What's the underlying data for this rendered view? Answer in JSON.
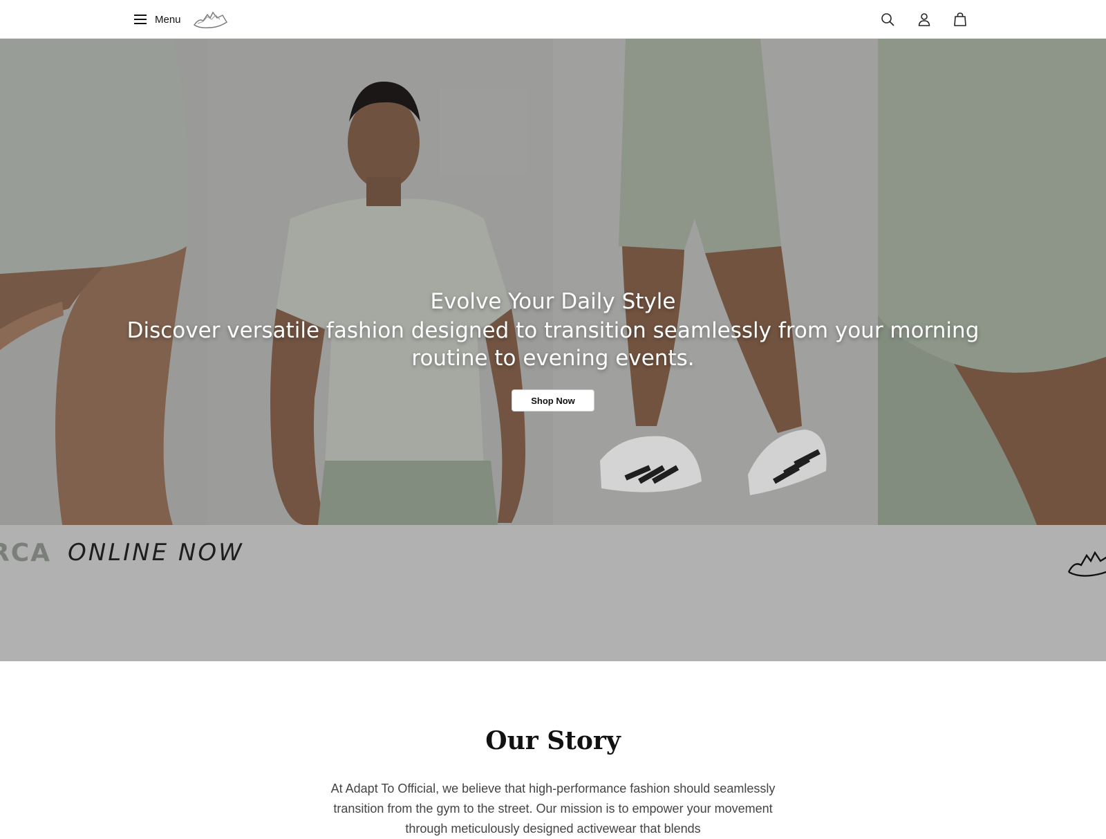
{
  "header": {
    "menu_label": "Menu",
    "icons": [
      "hamburger-icon",
      "mountain-logo",
      "search-icon",
      "account-icon",
      "bag-icon"
    ]
  },
  "hero": {
    "title": "Evolve Your Daily Style",
    "subtitle": "Discover versatile fashion designed to transition seamlessly from your morning routine to evening events.",
    "cta_label": "Shop Now"
  },
  "band": {
    "brand": "RCA",
    "tagline": "ONLINE NOW"
  },
  "story": {
    "title": "Our Story",
    "body": "At Adapt To Official, we believe that high-performance fashion should seamlessly transition from the gym to the street. Our mission is to empower your movement through meticulously designed activewear that blends"
  },
  "colors": {
    "band_bg": "#b1b1b1",
    "garment_sage": "#a8b3a2",
    "text_dark": "#111111"
  }
}
